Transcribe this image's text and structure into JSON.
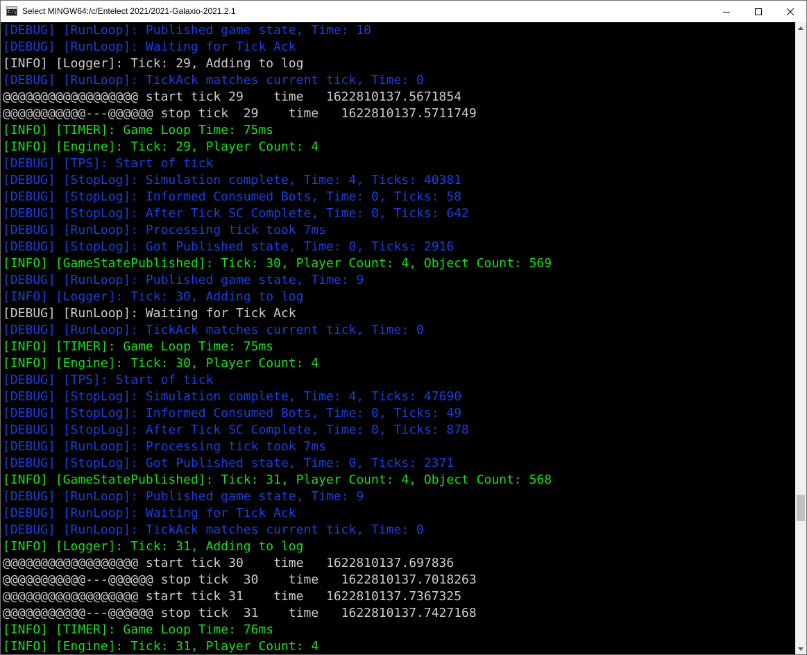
{
  "window": {
    "title": "Select MINGW64:/c/Entelect 2021/2021-Galaxio-2021.2.1",
    "icon": "console-app-icon",
    "icon_text": "C:\\"
  },
  "controls": [
    "minimize-icon",
    "maximize-icon",
    "close-icon"
  ],
  "colors": {
    "debug": "#1b3ee0",
    "plain": "#cccccc",
    "info": "#16e01e",
    "background": "#000000"
  },
  "console": {
    "lines": [
      {
        "text": "[DEBUG] [RunLoop]: Published game state, Time: 10",
        "color": "blue"
      },
      {
        "text": "[DEBUG] [RunLoop]: Waiting for Tick Ack",
        "color": "blue"
      },
      {
        "text": "[INFO] [Logger]: Tick: 29, Adding to log",
        "color": "white"
      },
      {
        "text": "[DEBUG] [RunLoop]: TickAck matches current tick, Time: 0",
        "color": "blue"
      },
      {
        "text": "@@@@@@@@@@@@@@@@@@ start tick 29    time   1622810137.5671854",
        "color": "white"
      },
      {
        "text": "@@@@@@@@@@@---@@@@@@ stop tick  29    time   1622810137.5711749",
        "color": "white"
      },
      {
        "text": "[INFO] [TIMER]: Game Loop Time: 75ms",
        "color": "green"
      },
      {
        "text": "[INFO] [Engine]: Tick: 29, Player Count: 4",
        "color": "green"
      },
      {
        "text": "[DEBUG] [TPS]: Start of tick",
        "color": "blue"
      },
      {
        "text": "[DEBUG] [StopLog]: Simulation complete, Time: 4, Ticks: 40381",
        "color": "blue"
      },
      {
        "text": "[DEBUG] [StopLog]: Informed Consumed Bots, Time: 0, Ticks: 58",
        "color": "blue"
      },
      {
        "text": "[DEBUG] [StopLog]: After Tick SC Complete, Time: 0, Ticks: 642",
        "color": "blue"
      },
      {
        "text": "[DEBUG] [RunLoop]: Processing tick took 7ms",
        "color": "blue"
      },
      {
        "text": "[DEBUG] [StopLog]: Got Published state, Time: 0, Ticks: 2916",
        "color": "blue"
      },
      {
        "text": "[INFO] [GameStatePublished]: Tick: 30, Player Count: 4, Object Count: 569",
        "color": "green"
      },
      {
        "text": "[DEBUG] [RunLoop]: Published game state, Time: 9",
        "color": "blue"
      },
      {
        "text": "[INFO] [Logger]: Tick: 30, Adding to log",
        "color": "blue"
      },
      {
        "text": "[DEBUG] [RunLoop]: Waiting for Tick Ack",
        "color": "white"
      },
      {
        "text": "[DEBUG] [RunLoop]: TickAck matches current tick, Time: 0",
        "color": "blue"
      },
      {
        "text": "[INFO] [TIMER]: Game Loop Time: 75ms",
        "color": "green"
      },
      {
        "text": "[INFO] [Engine]: Tick: 30, Player Count: 4",
        "color": "green"
      },
      {
        "text": "[DEBUG] [TPS]: Start of tick",
        "color": "blue"
      },
      {
        "text": "[DEBUG] [StopLog]: Simulation complete, Time: 4, Ticks: 47690",
        "color": "blue"
      },
      {
        "text": "[DEBUG] [StopLog]: Informed Consumed Bots, Time: 0, Ticks: 49",
        "color": "blue"
      },
      {
        "text": "[DEBUG] [StopLog]: After Tick SC Complete, Time: 0, Ticks: 878",
        "color": "blue"
      },
      {
        "text": "[DEBUG] [RunLoop]: Processing tick took 7ms",
        "color": "blue"
      },
      {
        "text": "[DEBUG] [StopLog]: Got Published state, Time: 0, Ticks: 2371",
        "color": "blue"
      },
      {
        "text": "[INFO] [GameStatePublished]: Tick: 31, Player Count: 4, Object Count: 568",
        "color": "green"
      },
      {
        "text": "[DEBUG] [RunLoop]: Published game state, Time: 9",
        "color": "blue"
      },
      {
        "text": "[DEBUG] [RunLoop]: Waiting for Tick Ack",
        "color": "blue"
      },
      {
        "text": "[DEBUG] [RunLoop]: TickAck matches current tick, Time: 0",
        "color": "blue"
      },
      {
        "text": "[INFO] [Logger]: Tick: 31, Adding to log",
        "color": "green"
      },
      {
        "text": "@@@@@@@@@@@@@@@@@@ start tick 30    time   1622810137.697836",
        "color": "white"
      },
      {
        "text": "@@@@@@@@@@@---@@@@@@ stop tick  30    time   1622810137.7018263",
        "color": "white"
      },
      {
        "text": "@@@@@@@@@@@@@@@@@@ start tick 31    time   1622810137.7367325",
        "color": "white"
      },
      {
        "text": "@@@@@@@@@@@---@@@@@@ stop tick  31    time   1622810137.7427168",
        "color": "white"
      },
      {
        "text": "[INFO] [TIMER]: Game Loop Time: 76ms",
        "color": "green"
      },
      {
        "text": "[INFO] [Engine]: Tick: 31, Player Count: 4",
        "color": "green"
      }
    ]
  },
  "scrollbar": {
    "up_icon": "scroll-up-arrow-icon",
    "down_icon": "scroll-down-arrow-icon",
    "position_fraction": 0.79
  }
}
